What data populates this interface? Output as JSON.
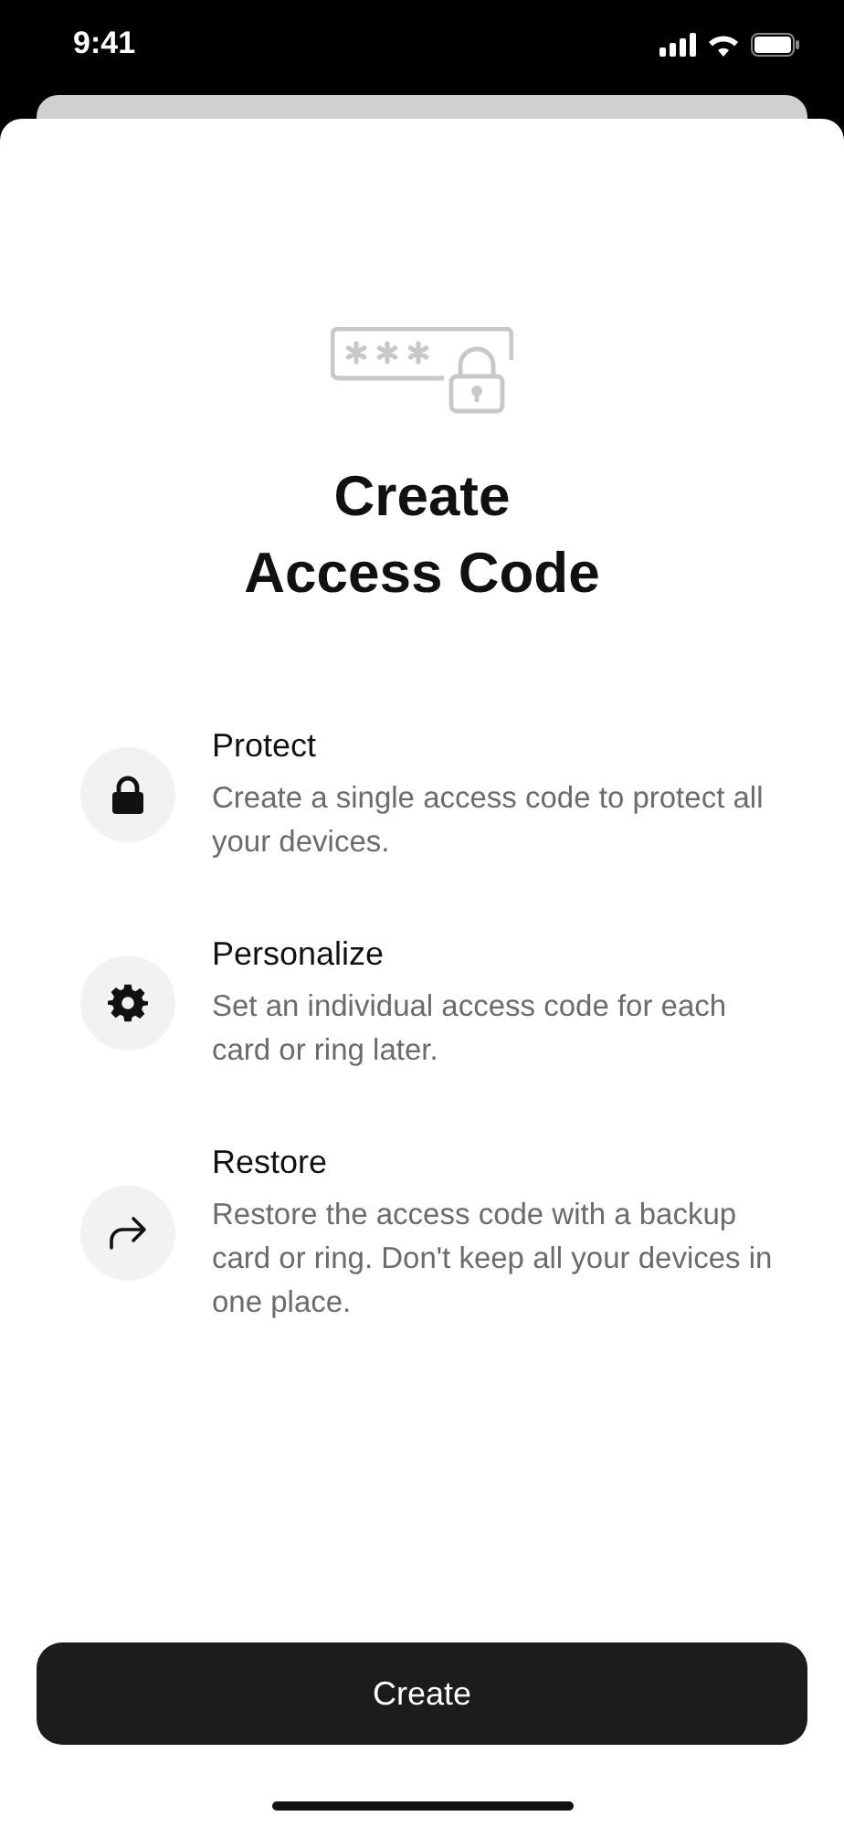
{
  "status_bar": {
    "time": "9:41"
  },
  "title": "Create\nAccess Code",
  "features": [
    {
      "kind": "lock",
      "title": "Protect",
      "description": "Create a single access code to protect all your devices."
    },
    {
      "kind": "gear",
      "title": "Personalize",
      "description": "Set an individual access code for each card or ring later."
    },
    {
      "kind": "share",
      "title": "Restore",
      "description": "Restore the access code with a backup card or ring. Don't keep all your devices in one place."
    }
  ],
  "button": {
    "label": "Create"
  }
}
